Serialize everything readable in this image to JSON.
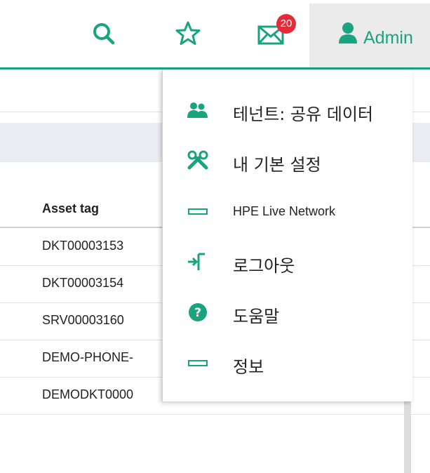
{
  "header": {
    "notification_count": "20",
    "user_label": "Admin",
    "accent_color": "#1aa37f",
    "badge_color": "#e32b3a",
    "icons": [
      "search-icon",
      "star-icon",
      "mail-icon",
      "user-icon"
    ]
  },
  "background_table": {
    "column_header": "Asset tag",
    "rows": [
      "DKT00003153",
      "DKT00003154",
      "SRV00003160",
      "DEMO-PHONE-",
      "DEMODKT0000"
    ]
  },
  "user_menu": {
    "items": [
      {
        "label": "테넌트: 공유 데이터",
        "icon": "users-icon"
      },
      {
        "label": "내 기본 설정",
        "icon": "wrench-icon"
      },
      {
        "label": "HPE Live Network",
        "icon": "rectangle-icon"
      },
      {
        "label": "로그아웃",
        "icon": "logout-icon"
      },
      {
        "label": "도움말",
        "icon": "help-icon"
      },
      {
        "label": "정보",
        "icon": "rectangle-icon"
      }
    ]
  }
}
